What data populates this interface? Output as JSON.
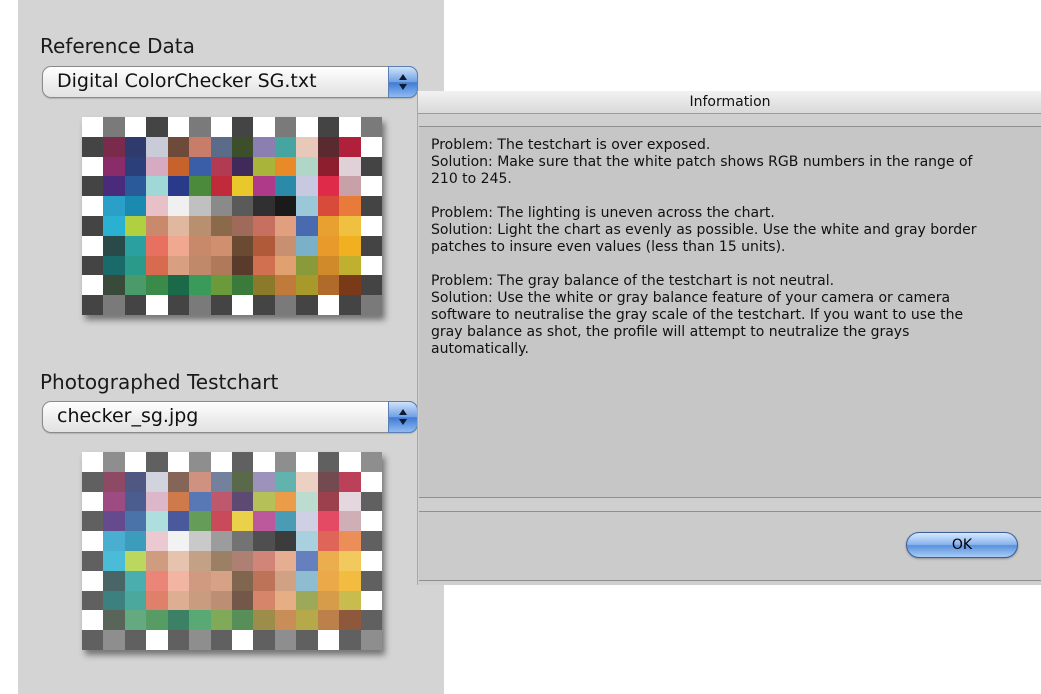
{
  "reference": {
    "label": "Reference Data",
    "selected": "Digital ColorChecker SG.txt",
    "stepper_icon": "up-down-arrows-icon"
  },
  "photographed": {
    "label": "Photographed Testchart",
    "selected": "checker_sg.jpg",
    "stepper_icon": "up-down-arrows-icon"
  },
  "info_window": {
    "title": "Information",
    "body": "Problem: The testchart is over exposed.\nSolution: Make sure that the white patch shows RGB numbers in the range of\n210 to 245.\n\nProblem: The lighting is uneven across the chart.\nSolution: Light the chart as evenly as possible. Use the white and gray border\npatches to insure even values (less than 15 units).\n\nProblem: The gray balance of the testchart is not neutral.\nSolution: Use the white or gray balance feature of your camera or camera\nsoftware to neutralise the gray scale of the testchart. If you want to use the\ngray balance as shot, the profile will attempt to neutralize the grays\nautomatically.",
    "ok_label": "OK"
  },
  "colors": {
    "panel_bg": "#d4d4d4",
    "ok_button_accent": "#5b8fdd"
  }
}
